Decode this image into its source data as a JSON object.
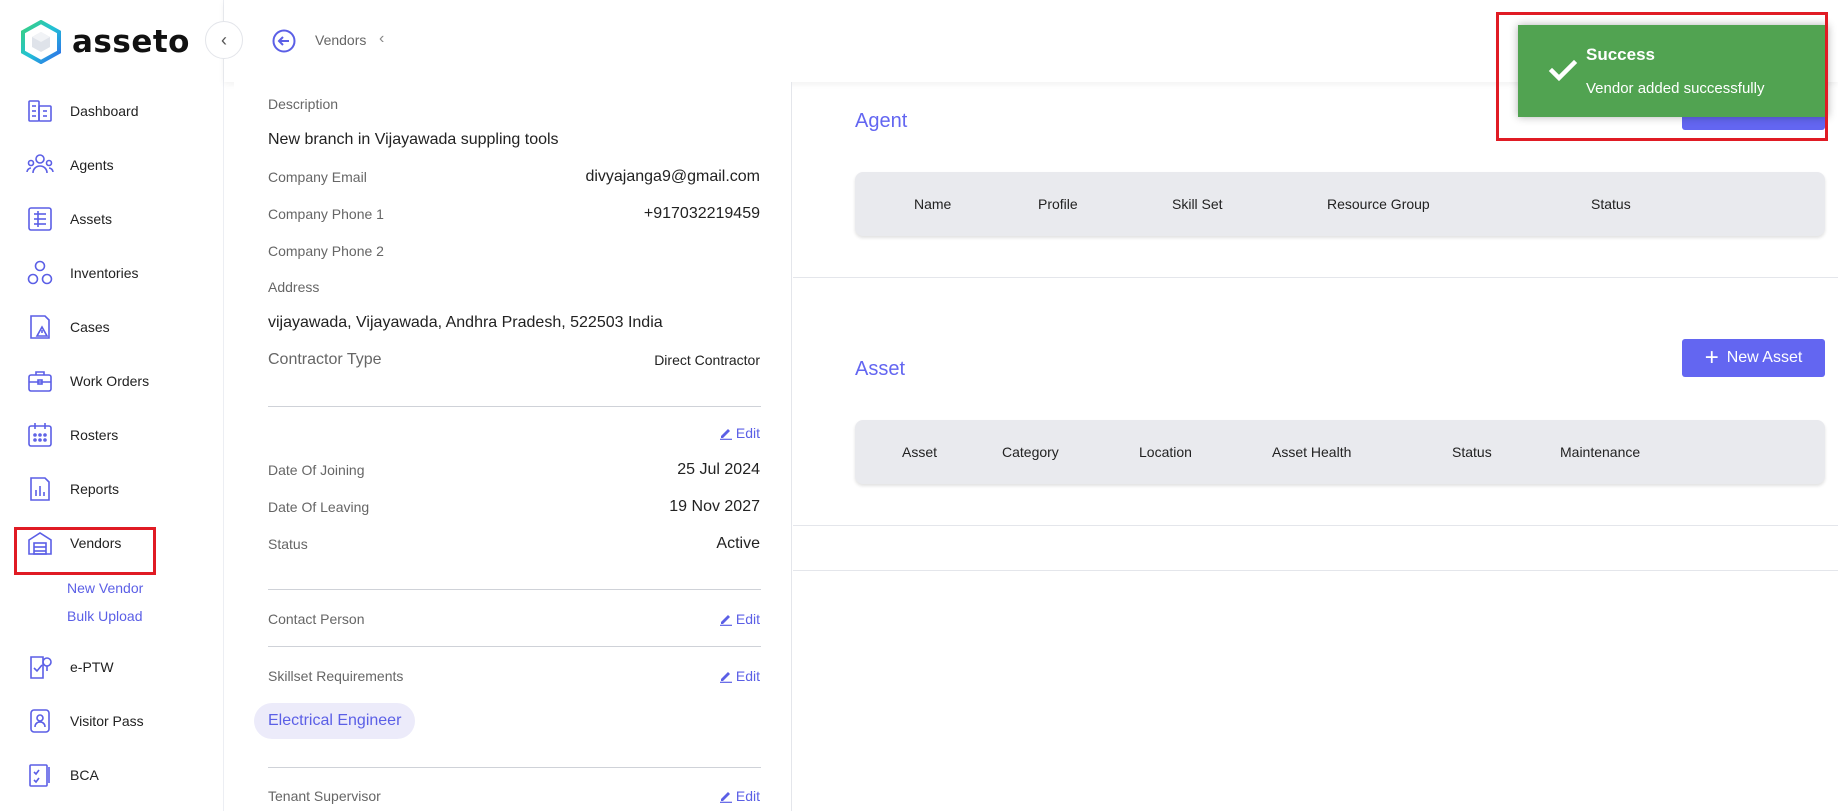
{
  "app": {
    "name": "asseto"
  },
  "sidebar": {
    "items": [
      {
        "label": "Dashboard",
        "icon": "dashboard-icon"
      },
      {
        "label": "Agents",
        "icon": "agents-icon"
      },
      {
        "label": "Assets",
        "icon": "assets-icon"
      },
      {
        "label": "Inventories",
        "icon": "inventories-icon"
      },
      {
        "label": "Cases",
        "icon": "cases-icon"
      },
      {
        "label": "Work Orders",
        "icon": "work-orders-icon"
      },
      {
        "label": "Rosters",
        "icon": "rosters-icon"
      },
      {
        "label": "Reports",
        "icon": "reports-icon"
      },
      {
        "label": "Vendors",
        "icon": "vendors-icon"
      },
      {
        "label": "e-PTW",
        "icon": "eptw-icon"
      },
      {
        "label": "Visitor Pass",
        "icon": "visitor-pass-icon"
      },
      {
        "label": "BCA",
        "icon": "bca-icon"
      }
    ],
    "vendor_sub": [
      "New Vendor",
      "Bulk Upload"
    ]
  },
  "header": {
    "breadcrumb": "Vendors"
  },
  "details": {
    "description_label": "Description",
    "description_value": "New branch in Vijayawada suppling tools",
    "email_label": "Company Email",
    "email_value": "divyajanga9@gmail.com",
    "phone1_label": "Company Phone 1",
    "phone1_value": "+917032219459",
    "phone2_label": "Company Phone 2",
    "address_label": "Address",
    "address_value": "vijayawada, Vijayawada, Andhra Pradesh, 522503 India",
    "contractor_label": "Contractor Type",
    "contractor_value": "Direct Contractor",
    "edit_label": "Edit",
    "joining_label": "Date Of Joining",
    "joining_value": "25 Jul 2024",
    "leaving_label": "Date Of Leaving",
    "leaving_value": "19 Nov 2027",
    "status_label": "Status",
    "status_value": "Active",
    "contact_label": "Contact Person",
    "skillset_label": "Skillset Requirements",
    "skill_chip": "Electrical Engineer",
    "supervisor_label": "Tenant Supervisor"
  },
  "agent": {
    "title": "Agent",
    "columns": [
      "Name",
      "Profile",
      "Skill Set",
      "Resource Group",
      "Status"
    ]
  },
  "asset": {
    "title": "Asset",
    "new_button": "New Asset",
    "columns": [
      "Asset",
      "Category",
      "Location",
      "Asset Health",
      "Status",
      "Maintenance"
    ]
  },
  "toast": {
    "title": "Success",
    "message": "Vendor added successfully"
  },
  "colors": {
    "accent": "#6366f1",
    "success": "#51a351",
    "highlight": "#e01b24"
  }
}
